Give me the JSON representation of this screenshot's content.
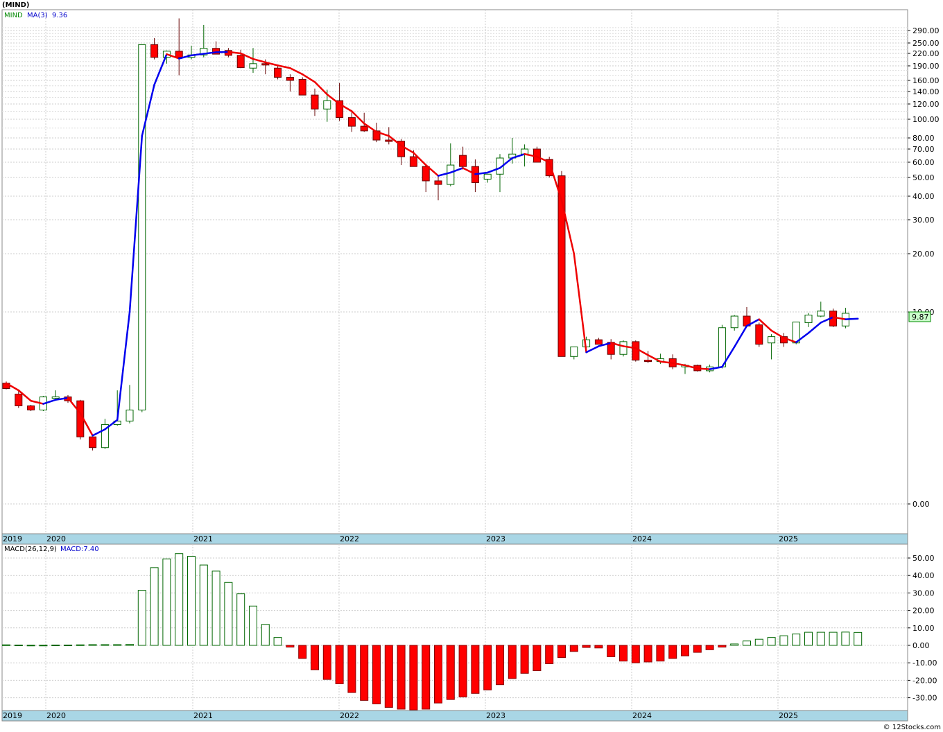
{
  "title": "(MIND)",
  "watermark": "© 12Stocks.com",
  "colors": {
    "up": "#00aa00",
    "down": "#ff0000",
    "ma_up": "#0000ee",
    "ma_down": "#ee0000",
    "axis_band": "#a9d6e5",
    "macd_up": "#006600",
    "macd_down": "#ff0000",
    "last_price_box": "#ccffcc"
  },
  "price_legend": {
    "symbol": "MIND",
    "ma_label": "MA(3)",
    "ma_value": "9.36"
  },
  "last_price": "9.87",
  "macd_legend": {
    "label": "MACD(26,12,9)",
    "value_label": "MACD:7.40"
  },
  "chart_data": [
    {
      "type": "candlestick",
      "scale": "log",
      "x_labels": [
        "2019",
        "2020",
        "2021",
        "2022",
        "2023",
        "2024",
        "2025"
      ],
      "y_ticks": [
        "290.00",
        "250.00",
        "220.00",
        "190.00",
        "160.00",
        "140.00",
        "120.00",
        "100.00",
        "80.00",
        "70.00",
        "60.00",
        "50.00",
        "40.00",
        "30.00",
        "20.00",
        "10.00",
        "0.00"
      ],
      "ohlc": [
        [
          4.6,
          4.7,
          4.25,
          4.3
        ],
        [
          4.0,
          4.2,
          3.3,
          3.4
        ],
        [
          3.4,
          3.45,
          3.15,
          3.2
        ],
        [
          3.2,
          3.9,
          3.15,
          3.85
        ],
        [
          3.85,
          4.2,
          3.75,
          3.85
        ],
        [
          3.85,
          3.95,
          3.55,
          3.65
        ],
        [
          3.65,
          3.7,
          1.95,
          2.05
        ],
        [
          2.05,
          2.05,
          1.55,
          1.65
        ],
        [
          1.65,
          2.8,
          1.6,
          2.55
        ],
        [
          2.55,
          4.2,
          2.5,
          2.7
        ],
        [
          2.7,
          4.5,
          2.6,
          3.2
        ],
        [
          3.2,
          245,
          3.1,
          245
        ],
        [
          245,
          265,
          205,
          210
        ],
        [
          210,
          228,
          195,
          226
        ],
        [
          226,
          335,
          170,
          210
        ],
        [
          210,
          242,
          205,
          216
        ],
        [
          216,
          310,
          210,
          234
        ],
        [
          234,
          255,
          222,
          218
        ],
        [
          228,
          235,
          210,
          215
        ],
        [
          215,
          230,
          185,
          186
        ],
        [
          185,
          235,
          175,
          195
        ],
        [
          195,
          205,
          172,
          192
        ],
        [
          185,
          193,
          162,
          166
        ],
        [
          166,
          172,
          140,
          160
        ],
        [
          162,
          166,
          135,
          134
        ],
        [
          134,
          145,
          104,
          113
        ],
        [
          113,
          143,
          97,
          125
        ],
        [
          125,
          155,
          98,
          102
        ],
        [
          102,
          109,
          86,
          92
        ],
        [
          92,
          108,
          86,
          87
        ],
        [
          87,
          96,
          76,
          78
        ],
        [
          78,
          91,
          74,
          77
        ],
        [
          77,
          79,
          58,
          64
        ],
        [
          64,
          69,
          57,
          57
        ],
        [
          57,
          59,
          42,
          48
        ],
        [
          48,
          51,
          38,
          46
        ],
        [
          46,
          75,
          45,
          58
        ],
        [
          65,
          72,
          55,
          57
        ],
        [
          57,
          62,
          42,
          47
        ],
        [
          49,
          52,
          47,
          52
        ],
        [
          52,
          66,
          42,
          63
        ],
        [
          63,
          80,
          59,
          66
        ],
        [
          66,
          74,
          57,
          70
        ],
        [
          70,
          72,
          60,
          60
        ],
        [
          62,
          64,
          50,
          51
        ],
        [
          51,
          54,
          6.3,
          6.3
        ],
        [
          6.3,
          7.0,
          6.1,
          7.0
        ],
        [
          7.0,
          7.8,
          6.9,
          7.55
        ],
        [
          7.55,
          7.7,
          7.2,
          7.2
        ],
        [
          7.35,
          7.6,
          6.1,
          6.45
        ],
        [
          6.45,
          7.5,
          6.3,
          7.4
        ],
        [
          7.4,
          7.5,
          5.95,
          6.05
        ],
        [
          6.05,
          6.7,
          5.85,
          5.95
        ],
        [
          5.95,
          6.5,
          5.8,
          6.15
        ],
        [
          6.15,
          6.45,
          5.45,
          5.6
        ],
        [
          5.6,
          5.8,
          5.15,
          5.7
        ],
        [
          5.7,
          5.75,
          5.3,
          5.35
        ],
        [
          5.35,
          5.75,
          5.25,
          5.6
        ],
        [
          5.6,
          8.8,
          5.5,
          8.55
        ],
        [
          8.55,
          9.7,
          8.3,
          9.6
        ],
        [
          9.6,
          10.6,
          8.6,
          8.7
        ],
        [
          8.8,
          9.0,
          7.0,
          7.2
        ],
        [
          7.3,
          8.0,
          6.1,
          7.8
        ],
        [
          7.8,
          8.1,
          7.0,
          7.3
        ],
        [
          7.3,
          8.0,
          7.2,
          9.05
        ],
        [
          9.0,
          9.9,
          8.6,
          9.7
        ],
        [
          9.6,
          11.3,
          9.5,
          10.1
        ],
        [
          10.1,
          10.4,
          8.6,
          8.7
        ],
        [
          8.7,
          10.5,
          8.5,
          9.87
        ]
      ],
      "ma": [
        4.6,
        4.2,
        3.65,
        3.5,
        3.7,
        3.8,
        3.05,
        2.1,
        2.35,
        2.75,
        10,
        82,
        152,
        218,
        207,
        215,
        219,
        223,
        224,
        220,
        206,
        198,
        191,
        185,
        172,
        157,
        135,
        120,
        110,
        95,
        86,
        82,
        73,
        67,
        58,
        51,
        53,
        56,
        52,
        53,
        56,
        63,
        66,
        64,
        60,
        38,
        20,
        6.6,
        7.05,
        7.3,
        7.05,
        6.9,
        6.4,
        5.95,
        5.85,
        5.7,
        5.5,
        5.45,
        5.6,
        7.0,
        8.7,
        9.3,
        8.3,
        7.7,
        7.35,
        8.1,
        9.0,
        9.5,
        9.3,
        9.36
      ]
    },
    {
      "type": "bar",
      "title": "MACD(26,12,9)",
      "x_labels": [
        "2019",
        "2020",
        "2021",
        "2022",
        "2023",
        "2024",
        "2025"
      ],
      "y_ticks": [
        "50.00",
        "40.00",
        "30.00",
        "20.00",
        "10.00",
        "0.00",
        "-10.00",
        "-20.00",
        "-30.00"
      ],
      "ylim": [
        -37,
        54
      ],
      "values": [
        0.3,
        0.2,
        0.1,
        0.1,
        0.2,
        0.2,
        0.3,
        0.4,
        0.4,
        0.4,
        0.5,
        31.5,
        44.5,
        49.5,
        52.5,
        51,
        46,
        42.5,
        36,
        29.5,
        22.5,
        12,
        4.5,
        -1,
        -7.5,
        -14,
        -19.5,
        -22,
        -27,
        -31.5,
        -33.5,
        -35.5,
        -36.5,
        -37,
        -36.5,
        -33,
        -31,
        -29.5,
        -27.5,
        -25.5,
        -22.5,
        -19,
        -16,
        -14.5,
        -10.5,
        -7,
        -3.5,
        -1.2,
        -1.5,
        -6.5,
        -9,
        -10,
        -9.5,
        -9,
        -7.5,
        -6,
        -4,
        -2.5,
        -1,
        0.8,
        2.5,
        3.5,
        4.5,
        5.5,
        6.5,
        7.5,
        7.5,
        7.5,
        7.6,
        7.4
      ]
    }
  ]
}
